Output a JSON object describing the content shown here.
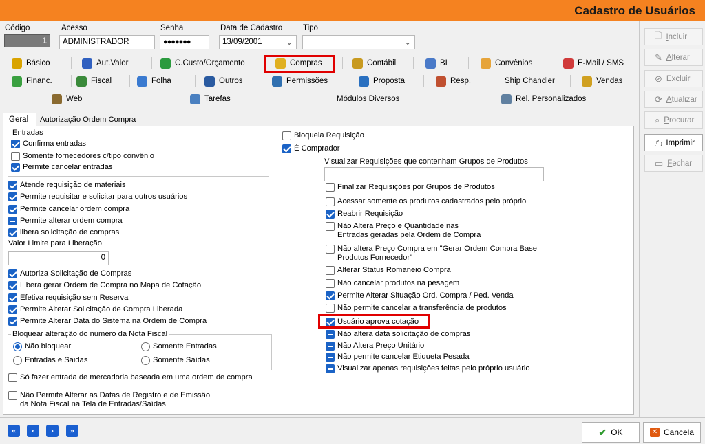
{
  "window": {
    "title": "Cadastro de Usuários"
  },
  "header": {
    "codigo_label": "Código",
    "codigo_value": "1",
    "acesso_label": "Acesso",
    "acesso_value": "ADMINISTRADOR",
    "senha_label": "Senha",
    "senha_value": "●●●●●●●",
    "data_label": "Data de Cadastro",
    "data_value": "13/09/2001",
    "tipo_label": "Tipo",
    "tipo_value": ""
  },
  "tabs_row1": [
    "Básico",
    "Aut.Valor",
    "C.Custo/Orçamento",
    "Compras",
    "Contábil",
    "BI",
    "Convênios",
    "E-Mail / SMS"
  ],
  "tabs_row2": [
    "Financ.",
    "Fiscal",
    "Folha",
    "Outros",
    "Permissões",
    "Proposta",
    "Resp.",
    "Ship Chandler",
    "Vendas"
  ],
  "tabs_row3": [
    "Web",
    "Tarefas",
    "Módulos Diversos",
    "Rel. Personalizados"
  ],
  "subtabs": [
    "Geral",
    "Autorização Ordem Compra"
  ],
  "entradas": {
    "title": "Entradas",
    "items": [
      {
        "label": "Confirma entradas",
        "state": "on"
      },
      {
        "label": "Somente fornecedores c/tipo convênio",
        "state": "off"
      },
      {
        "label": "Permite cancelar entradas",
        "state": "on"
      }
    ]
  },
  "left_checks_a": [
    {
      "label": "Atende requisição de materiais",
      "state": "on"
    },
    {
      "label": "Permite requisitar e solicitar para outros usuários",
      "state": "on"
    },
    {
      "label": "Permite cancelar ordem compra",
      "state": "on"
    },
    {
      "label": "Permite alterar ordem compra",
      "state": "ind"
    },
    {
      "label": "libera solicitação de compras",
      "state": "on"
    }
  ],
  "valor_limite": {
    "label": "Valor Limite para Liberação",
    "value": "0"
  },
  "left_checks_b": [
    {
      "label": "Autoriza Solicitação de Compras",
      "state": "on"
    },
    {
      "label": "Libera gerar Ordem de Compra no Mapa de Cotação",
      "state": "on"
    },
    {
      "label": "Efetiva requisição sem Reserva",
      "state": "on"
    },
    {
      "label": "Permite Alterar Solicitação de Compra Liberada",
      "state": "on"
    },
    {
      "label": "Permite Alterar Data do Sistema na Ordem de Compra",
      "state": "on"
    }
  ],
  "nota_fiscal": {
    "title": "Bloquear alteração do número da Nota Fiscal",
    "options": [
      "Não bloquear",
      "Somente Entradas",
      "Entradas e Saidas",
      "Somente Saídas"
    ],
    "selected": "Não bloquear"
  },
  "left_checks_c": [
    {
      "label": "Só fazer entrada de mercadoria baseada em uma ordem de compra",
      "state": "off"
    },
    {
      "label": "Não Permite Alterar as Datas de Registro e de Emissão",
      "label2": "da Nota Fiscal na Tela de Entradas/Saídas",
      "state": "off"
    }
  ],
  "right_top": [
    {
      "label": "Bloqueia Requisição",
      "state": "off"
    },
    {
      "label": "É Comprador",
      "state": "on"
    }
  ],
  "visualizar_grupos": {
    "label": "Visualizar Requisições que contenham Grupos de Produtos",
    "value": ""
  },
  "right_checks": [
    {
      "label": "Finalizar Requisições por Grupos de Produtos",
      "state": "off"
    },
    {
      "label": "Acessar somente os produtos cadastrados pelo próprio",
      "state": "off"
    },
    {
      "label": "Reabrir Requisição",
      "state": "on"
    },
    {
      "label": "Não Altera Preço e Quantidade nas",
      "label2": "Entradas geradas pela Ordem de Compra",
      "state": "off"
    },
    {
      "label": "Não altera Preço Compra em \"Gerar Ordem Compra Base",
      "label2": "Produtos Fornecedor\"",
      "state": "off"
    },
    {
      "label": "Alterar Status Romaneio Compra",
      "state": "off"
    },
    {
      "label": "Não cancelar produtos na pesagem",
      "state": "off"
    },
    {
      "label": "Permite Alterar Situação Ord. Compra / Ped. Venda",
      "state": "on"
    },
    {
      "label": "Não permite cancelar a transferência de produtos",
      "state": "off"
    },
    {
      "label": "Usuário aprova cotação",
      "state": "on"
    },
    {
      "label": "Não  altera data solicitação de compras",
      "state": "ind"
    },
    {
      "label": "Não Altera Preço Unitário",
      "state": "ind"
    },
    {
      "label": "Não permite cancelar Etiqueta Pesada",
      "state": "ind"
    },
    {
      "label": "Visualizar apenas requisições feitas pelo próprio usuário",
      "state": "ind"
    }
  ],
  "side_buttons": [
    {
      "key": "I",
      "rest": "ncluir",
      "active": false
    },
    {
      "key": "A",
      "rest": "lterar",
      "active": false
    },
    {
      "key": "E",
      "rest": "xcluir",
      "active": false
    },
    {
      "key": "A",
      "rest": "tualizar",
      "active": false
    },
    {
      "key": "P",
      "rest": "rocurar",
      "active": false
    },
    {
      "key": "I",
      "rest": "mprimir",
      "active": true
    },
    {
      "key": "F",
      "rest": "echar",
      "active": false
    }
  ],
  "footer": {
    "ok": "OK",
    "cancel": "Cancela",
    "nav": [
      "«",
      "‹",
      "›",
      "»"
    ]
  },
  "colors": {
    "title_bar": "#f58220",
    "accent": "#1b63c6",
    "highlight": "#e00000"
  }
}
